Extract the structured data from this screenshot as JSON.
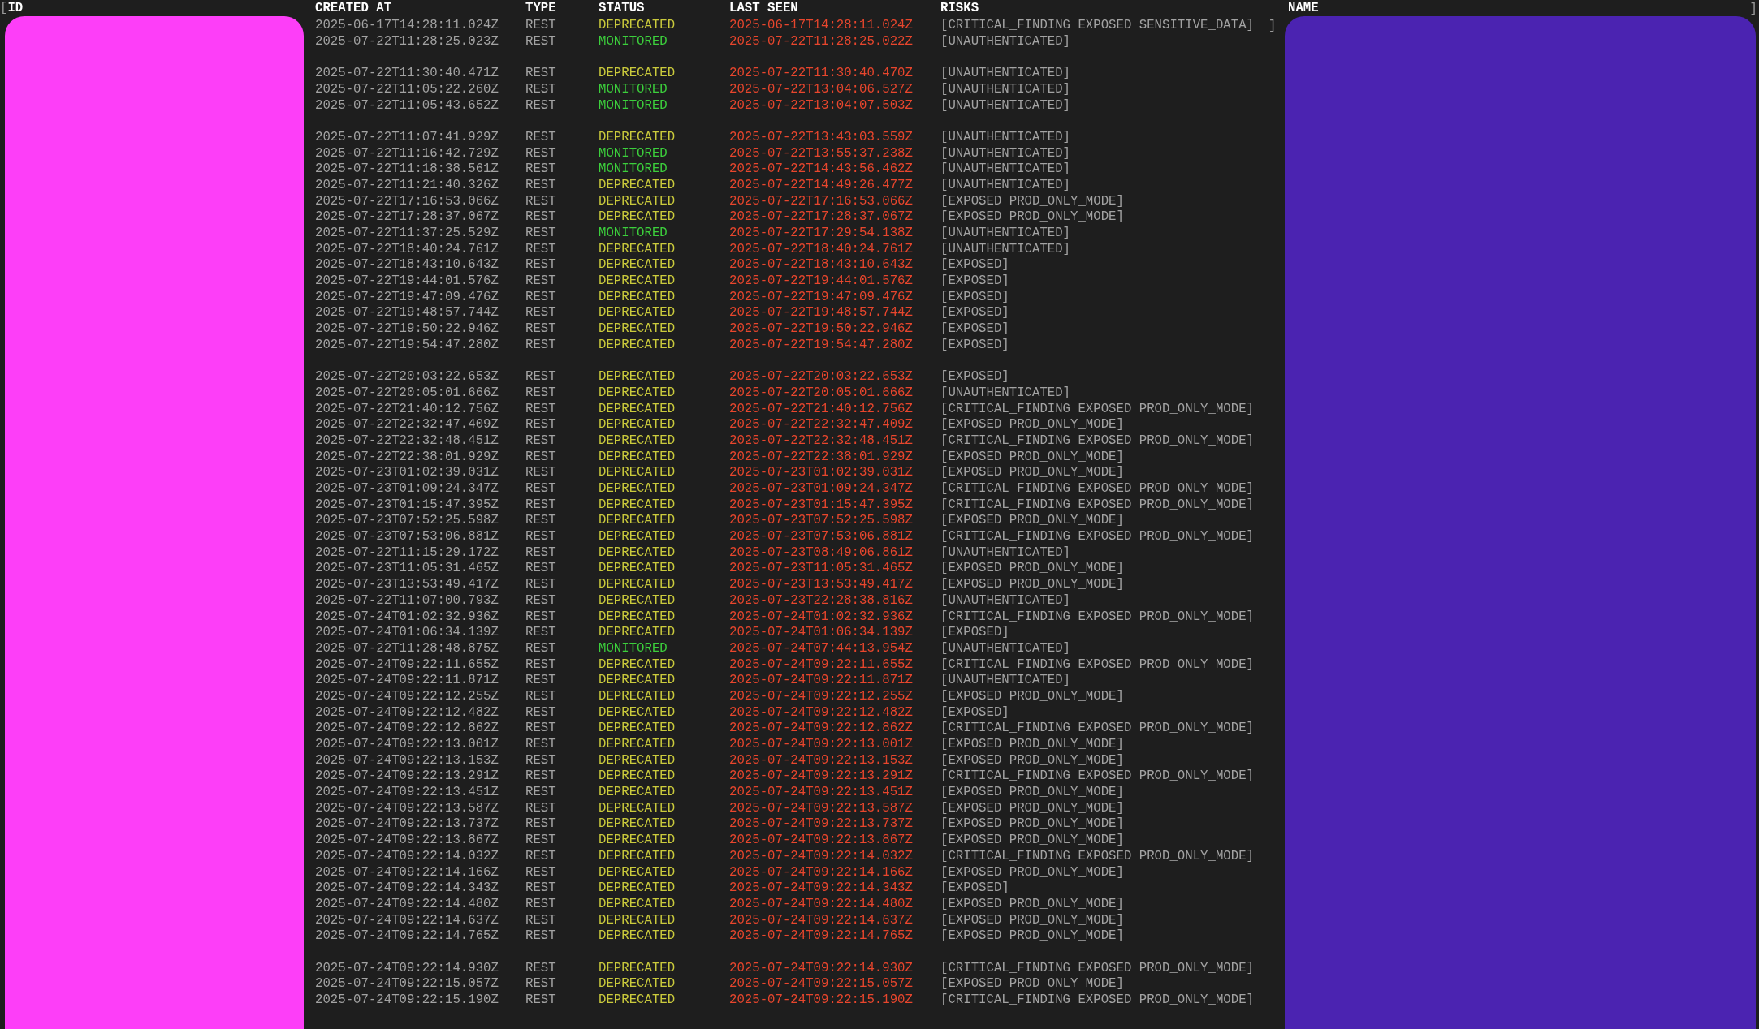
{
  "header_open": "[",
  "header_close": "]",
  "row_close": "]",
  "columns": [
    {
      "label": "ID",
      "redacted": true
    },
    {
      "label": "CREATED AT",
      "redacted": false
    },
    {
      "label": "TYPE",
      "redacted": false
    },
    {
      "label": "STATUS",
      "redacted": false
    },
    {
      "label": "LAST SEEN",
      "redacted": false
    },
    {
      "label": "RISKS",
      "redacted": false
    },
    {
      "label": "NAME",
      "redacted": true
    }
  ],
  "groups": [
    [
      {
        "created_at": "2025-06-17T14:28:11.024Z",
        "type": "REST",
        "status": {
          "text": "DEPRECATED",
          "color": "#caca3c"
        },
        "last_seen": "2025-06-17T14:28:11.024Z",
        "risks": "[CRITICAL_FINDING EXPOSED SENSITIVE_DATA]"
      },
      {
        "created_at": "2025-07-22T11:28:25.023Z",
        "type": "REST",
        "status": {
          "text": "MONITORED",
          "color": "#3ccf3c"
        },
        "last_seen": "2025-07-22T11:28:25.022Z",
        "risks": "[UNAUTHENTICATED]"
      }
    ],
    [
      {
        "created_at": "2025-07-22T11:30:40.471Z",
        "type": "REST",
        "status": {
          "text": "DEPRECATED",
          "color": "#caca3c"
        },
        "last_seen": "2025-07-22T11:30:40.470Z",
        "risks": "[UNAUTHENTICATED]"
      },
      {
        "created_at": "2025-07-22T11:05:22.260Z",
        "type": "REST",
        "status": {
          "text": "MONITORED",
          "color": "#3ccf3c"
        },
        "last_seen": "2025-07-22T13:04:06.527Z",
        "risks": "[UNAUTHENTICATED]"
      },
      {
        "created_at": "2025-07-22T11:05:43.652Z",
        "type": "REST",
        "status": {
          "text": "MONITORED",
          "color": "#3ccf3c"
        },
        "last_seen": "2025-07-22T13:04:07.503Z",
        "risks": "[UNAUTHENTICATED]"
      }
    ],
    [
      {
        "created_at": "2025-07-22T11:07:41.929Z",
        "type": "REST",
        "status": {
          "text": "DEPRECATED",
          "color": "#caca3c"
        },
        "last_seen": "2025-07-22T13:43:03.559Z",
        "risks": "[UNAUTHENTICATED]"
      },
      {
        "created_at": "2025-07-22T11:16:42.729Z",
        "type": "REST",
        "status": {
          "text": "MONITORED",
          "color": "#3ccf3c"
        },
        "last_seen": "2025-07-22T13:55:37.238Z",
        "risks": "[UNAUTHENTICATED]"
      },
      {
        "created_at": "2025-07-22T11:18:38.561Z",
        "type": "REST",
        "status": {
          "text": "MONITORED",
          "color": "#3ccf3c"
        },
        "last_seen": "2025-07-22T14:43:56.462Z",
        "risks": "[UNAUTHENTICATED]"
      },
      {
        "created_at": "2025-07-22T11:21:40.326Z",
        "type": "REST",
        "status": {
          "text": "DEPRECATED",
          "color": "#caca3c"
        },
        "last_seen": "2025-07-22T14:49:26.477Z",
        "risks": "[UNAUTHENTICATED]"
      },
      {
        "created_at": "2025-07-22T17:16:53.066Z",
        "type": "REST",
        "status": {
          "text": "DEPRECATED",
          "color": "#caca3c"
        },
        "last_seen": "2025-07-22T17:16:53.066Z",
        "risks": "[EXPOSED PROD_ONLY_MODE]"
      },
      {
        "created_at": "2025-07-22T17:28:37.067Z",
        "type": "REST",
        "status": {
          "text": "DEPRECATED",
          "color": "#caca3c"
        },
        "last_seen": "2025-07-22T17:28:37.067Z",
        "risks": "[EXPOSED PROD_ONLY_MODE]"
      },
      {
        "created_at": "2025-07-22T11:37:25.529Z",
        "type": "REST",
        "status": {
          "text": "MONITORED",
          "color": "#3ccf3c"
        },
        "last_seen": "2025-07-22T17:29:54.138Z",
        "risks": "[UNAUTHENTICATED]"
      },
      {
        "created_at": "2025-07-22T18:40:24.761Z",
        "type": "REST",
        "status": {
          "text": "DEPRECATED",
          "color": "#caca3c"
        },
        "last_seen": "2025-07-22T18:40:24.761Z",
        "risks": "[UNAUTHENTICATED]"
      },
      {
        "created_at": "2025-07-22T18:43:10.643Z",
        "type": "REST",
        "status": {
          "text": "DEPRECATED",
          "color": "#caca3c"
        },
        "last_seen": "2025-07-22T18:43:10.643Z",
        "risks": "[EXPOSED]"
      },
      {
        "created_at": "2025-07-22T19:44:01.576Z",
        "type": "REST",
        "status": {
          "text": "DEPRECATED",
          "color": "#caca3c"
        },
        "last_seen": "2025-07-22T19:44:01.576Z",
        "risks": "[EXPOSED]"
      },
      {
        "created_at": "2025-07-22T19:47:09.476Z",
        "type": "REST",
        "status": {
          "text": "DEPRECATED",
          "color": "#caca3c"
        },
        "last_seen": "2025-07-22T19:47:09.476Z",
        "risks": "[EXPOSED]"
      },
      {
        "created_at": "2025-07-22T19:48:57.744Z",
        "type": "REST",
        "status": {
          "text": "DEPRECATED",
          "color": "#caca3c"
        },
        "last_seen": "2025-07-22T19:48:57.744Z",
        "risks": "[EXPOSED]"
      },
      {
        "created_at": "2025-07-22T19:50:22.946Z",
        "type": "REST",
        "status": {
          "text": "DEPRECATED",
          "color": "#caca3c"
        },
        "last_seen": "2025-07-22T19:50:22.946Z",
        "risks": "[EXPOSED]"
      },
      {
        "created_at": "2025-07-22T19:54:47.280Z",
        "type": "REST",
        "status": {
          "text": "DEPRECATED",
          "color": "#caca3c"
        },
        "last_seen": "2025-07-22T19:54:47.280Z",
        "risks": "[EXPOSED]"
      }
    ],
    [
      {
        "created_at": "2025-07-22T20:03:22.653Z",
        "type": "REST",
        "status": {
          "text": "DEPRECATED",
          "color": "#caca3c"
        },
        "last_seen": "2025-07-22T20:03:22.653Z",
        "risks": "[EXPOSED]"
      },
      {
        "created_at": "2025-07-22T20:05:01.666Z",
        "type": "REST",
        "status": {
          "text": "DEPRECATED",
          "color": "#caca3c"
        },
        "last_seen": "2025-07-22T20:05:01.666Z",
        "risks": "[UNAUTHENTICATED]"
      },
      {
        "created_at": "2025-07-22T21:40:12.756Z",
        "type": "REST",
        "status": {
          "text": "DEPRECATED",
          "color": "#caca3c"
        },
        "last_seen": "2025-07-22T21:40:12.756Z",
        "risks": "[CRITICAL_FINDING EXPOSED PROD_ONLY_MODE]"
      },
      {
        "created_at": "2025-07-22T22:32:47.409Z",
        "type": "REST",
        "status": {
          "text": "DEPRECATED",
          "color": "#caca3c"
        },
        "last_seen": "2025-07-22T22:32:47.409Z",
        "risks": "[EXPOSED PROD_ONLY_MODE]"
      },
      {
        "created_at": "2025-07-22T22:32:48.451Z",
        "type": "REST",
        "status": {
          "text": "DEPRECATED",
          "color": "#caca3c"
        },
        "last_seen": "2025-07-22T22:32:48.451Z",
        "risks": "[CRITICAL_FINDING EXPOSED PROD_ONLY_MODE]"
      },
      {
        "created_at": "2025-07-22T22:38:01.929Z",
        "type": "REST",
        "status": {
          "text": "DEPRECATED",
          "color": "#caca3c"
        },
        "last_seen": "2025-07-22T22:38:01.929Z",
        "risks": "[EXPOSED PROD_ONLY_MODE]"
      },
      {
        "created_at": "2025-07-23T01:02:39.031Z",
        "type": "REST",
        "status": {
          "text": "DEPRECATED",
          "color": "#caca3c"
        },
        "last_seen": "2025-07-23T01:02:39.031Z",
        "risks": "[EXPOSED PROD_ONLY_MODE]"
      },
      {
        "created_at": "2025-07-23T01:09:24.347Z",
        "type": "REST",
        "status": {
          "text": "DEPRECATED",
          "color": "#caca3c"
        },
        "last_seen": "2025-07-23T01:09:24.347Z",
        "risks": "[CRITICAL_FINDING EXPOSED PROD_ONLY_MODE]"
      },
      {
        "created_at": "2025-07-23T01:15:47.395Z",
        "type": "REST",
        "status": {
          "text": "DEPRECATED",
          "color": "#caca3c"
        },
        "last_seen": "2025-07-23T01:15:47.395Z",
        "risks": "[CRITICAL_FINDING EXPOSED PROD_ONLY_MODE]"
      },
      {
        "created_at": "2025-07-23T07:52:25.598Z",
        "type": "REST",
        "status": {
          "text": "DEPRECATED",
          "color": "#caca3c"
        },
        "last_seen": "2025-07-23T07:52:25.598Z",
        "risks": "[EXPOSED PROD_ONLY_MODE]"
      },
      {
        "created_at": "2025-07-23T07:53:06.881Z",
        "type": "REST",
        "status": {
          "text": "DEPRECATED",
          "color": "#caca3c"
        },
        "last_seen": "2025-07-23T07:53:06.881Z",
        "risks": "[CRITICAL_FINDING EXPOSED PROD_ONLY_MODE]"
      },
      {
        "created_at": "2025-07-22T11:15:29.172Z",
        "type": "REST",
        "status": {
          "text": "DEPRECATED",
          "color": "#caca3c"
        },
        "last_seen": "2025-07-23T08:49:06.861Z",
        "risks": "[UNAUTHENTICATED]"
      },
      {
        "created_at": "2025-07-23T11:05:31.465Z",
        "type": "REST",
        "status": {
          "text": "DEPRECATED",
          "color": "#caca3c"
        },
        "last_seen": "2025-07-23T11:05:31.465Z",
        "risks": "[EXPOSED PROD_ONLY_MODE]"
      },
      {
        "created_at": "2025-07-23T13:53:49.417Z",
        "type": "REST",
        "status": {
          "text": "DEPRECATED",
          "color": "#caca3c"
        },
        "last_seen": "2025-07-23T13:53:49.417Z",
        "risks": "[EXPOSED PROD_ONLY_MODE]"
      },
      {
        "created_at": "2025-07-22T11:07:00.793Z",
        "type": "REST",
        "status": {
          "text": "DEPRECATED",
          "color": "#caca3c"
        },
        "last_seen": "2025-07-23T22:28:38.816Z",
        "risks": "[UNAUTHENTICATED]"
      },
      {
        "created_at": "2025-07-24T01:02:32.936Z",
        "type": "REST",
        "status": {
          "text": "DEPRECATED",
          "color": "#caca3c"
        },
        "last_seen": "2025-07-24T01:02:32.936Z",
        "risks": "[CRITICAL_FINDING EXPOSED PROD_ONLY_MODE]"
      },
      {
        "created_at": "2025-07-24T01:06:34.139Z",
        "type": "REST",
        "status": {
          "text": "DEPRECATED",
          "color": "#caca3c"
        },
        "last_seen": "2025-07-24T01:06:34.139Z",
        "risks": "[EXPOSED]"
      },
      {
        "created_at": "2025-07-22T11:28:48.875Z",
        "type": "REST",
        "status": {
          "text": "MONITORED",
          "color": "#3ccf3c"
        },
        "last_seen": "2025-07-24T07:44:13.954Z",
        "risks": "[UNAUTHENTICATED]"
      },
      {
        "created_at": "2025-07-24T09:22:11.655Z",
        "type": "REST",
        "status": {
          "text": "DEPRECATED",
          "color": "#caca3c"
        },
        "last_seen": "2025-07-24T09:22:11.655Z",
        "risks": "[CRITICAL_FINDING EXPOSED PROD_ONLY_MODE]"
      },
      {
        "created_at": "2025-07-24T09:22:11.871Z",
        "type": "REST",
        "status": {
          "text": "DEPRECATED",
          "color": "#caca3c"
        },
        "last_seen": "2025-07-24T09:22:11.871Z",
        "risks": "[UNAUTHENTICATED]"
      },
      {
        "created_at": "2025-07-24T09:22:12.255Z",
        "type": "REST",
        "status": {
          "text": "DEPRECATED",
          "color": "#caca3c"
        },
        "last_seen": "2025-07-24T09:22:12.255Z",
        "risks": "[EXPOSED PROD_ONLY_MODE]"
      },
      {
        "created_at": "2025-07-24T09:22:12.482Z",
        "type": "REST",
        "status": {
          "text": "DEPRECATED",
          "color": "#caca3c"
        },
        "last_seen": "2025-07-24T09:22:12.482Z",
        "risks": "[EXPOSED]"
      },
      {
        "created_at": "2025-07-24T09:22:12.862Z",
        "type": "REST",
        "status": {
          "text": "DEPRECATED",
          "color": "#caca3c"
        },
        "last_seen": "2025-07-24T09:22:12.862Z",
        "risks": "[CRITICAL_FINDING EXPOSED PROD_ONLY_MODE]"
      },
      {
        "created_at": "2025-07-24T09:22:13.001Z",
        "type": "REST",
        "status": {
          "text": "DEPRECATED",
          "color": "#caca3c"
        },
        "last_seen": "2025-07-24T09:22:13.001Z",
        "risks": "[EXPOSED PROD_ONLY_MODE]"
      },
      {
        "created_at": "2025-07-24T09:22:13.153Z",
        "type": "REST",
        "status": {
          "text": "DEPRECATED",
          "color": "#caca3c"
        },
        "last_seen": "2025-07-24T09:22:13.153Z",
        "risks": "[EXPOSED PROD_ONLY_MODE]"
      },
      {
        "created_at": "2025-07-24T09:22:13.291Z",
        "type": "REST",
        "status": {
          "text": "DEPRECATED",
          "color": "#caca3c"
        },
        "last_seen": "2025-07-24T09:22:13.291Z",
        "risks": "[CRITICAL_FINDING EXPOSED PROD_ONLY_MODE]"
      },
      {
        "created_at": "2025-07-24T09:22:13.451Z",
        "type": "REST",
        "status": {
          "text": "DEPRECATED",
          "color": "#caca3c"
        },
        "last_seen": "2025-07-24T09:22:13.451Z",
        "risks": "[EXPOSED PROD_ONLY_MODE]"
      },
      {
        "created_at": "2025-07-24T09:22:13.587Z",
        "type": "REST",
        "status": {
          "text": "DEPRECATED",
          "color": "#caca3c"
        },
        "last_seen": "2025-07-24T09:22:13.587Z",
        "risks": "[EXPOSED PROD_ONLY_MODE]"
      },
      {
        "created_at": "2025-07-24T09:22:13.737Z",
        "type": "REST",
        "status": {
          "text": "DEPRECATED",
          "color": "#caca3c"
        },
        "last_seen": "2025-07-24T09:22:13.737Z",
        "risks": "[EXPOSED PROD_ONLY_MODE]"
      },
      {
        "created_at": "2025-07-24T09:22:13.867Z",
        "type": "REST",
        "status": {
          "text": "DEPRECATED",
          "color": "#caca3c"
        },
        "last_seen": "2025-07-24T09:22:13.867Z",
        "risks": "[EXPOSED PROD_ONLY_MODE]"
      },
      {
        "created_at": "2025-07-24T09:22:14.032Z",
        "type": "REST",
        "status": {
          "text": "DEPRECATED",
          "color": "#caca3c"
        },
        "last_seen": "2025-07-24T09:22:14.032Z",
        "risks": "[CRITICAL_FINDING EXPOSED PROD_ONLY_MODE]"
      },
      {
        "created_at": "2025-07-24T09:22:14.166Z",
        "type": "REST",
        "status": {
          "text": "DEPRECATED",
          "color": "#caca3c"
        },
        "last_seen": "2025-07-24T09:22:14.166Z",
        "risks": "[EXPOSED PROD_ONLY_MODE]"
      },
      {
        "created_at": "2025-07-24T09:22:14.343Z",
        "type": "REST",
        "status": {
          "text": "DEPRECATED",
          "color": "#caca3c"
        },
        "last_seen": "2025-07-24T09:22:14.343Z",
        "risks": "[EXPOSED]"
      },
      {
        "created_at": "2025-07-24T09:22:14.480Z",
        "type": "REST",
        "status": {
          "text": "DEPRECATED",
          "color": "#caca3c"
        },
        "last_seen": "2025-07-24T09:22:14.480Z",
        "risks": "[EXPOSED PROD_ONLY_MODE]"
      },
      {
        "created_at": "2025-07-24T09:22:14.637Z",
        "type": "REST",
        "status": {
          "text": "DEPRECATED",
          "color": "#caca3c"
        },
        "last_seen": "2025-07-24T09:22:14.637Z",
        "risks": "[EXPOSED PROD_ONLY_MODE]"
      },
      {
        "created_at": "2025-07-24T09:22:14.765Z",
        "type": "REST",
        "status": {
          "text": "DEPRECATED",
          "color": "#caca3c"
        },
        "last_seen": "2025-07-24T09:22:14.765Z",
        "risks": "[EXPOSED PROD_ONLY_MODE]"
      }
    ],
    [
      {
        "created_at": "2025-07-24T09:22:14.930Z",
        "type": "REST",
        "status": {
          "text": "DEPRECATED",
          "color": "#caca3c"
        },
        "last_seen": "2025-07-24T09:22:14.930Z",
        "risks": "[CRITICAL_FINDING EXPOSED PROD_ONLY_MODE]"
      },
      {
        "created_at": "2025-07-24T09:22:15.057Z",
        "type": "REST",
        "status": {
          "text": "DEPRECATED",
          "color": "#caca3c"
        },
        "last_seen": "2025-07-24T09:22:15.057Z",
        "risks": "[EXPOSED PROD_ONLY_MODE]"
      },
      {
        "created_at": "2025-07-24T09:22:15.190Z",
        "type": "REST",
        "status": {
          "text": "DEPRECATED",
          "color": "#caca3c"
        },
        "last_seen": "2025-07-24T09:22:15.190Z",
        "risks": "[CRITICAL_FINDING EXPOSED PROD_ONLY_MODE]"
      }
    ]
  ]
}
